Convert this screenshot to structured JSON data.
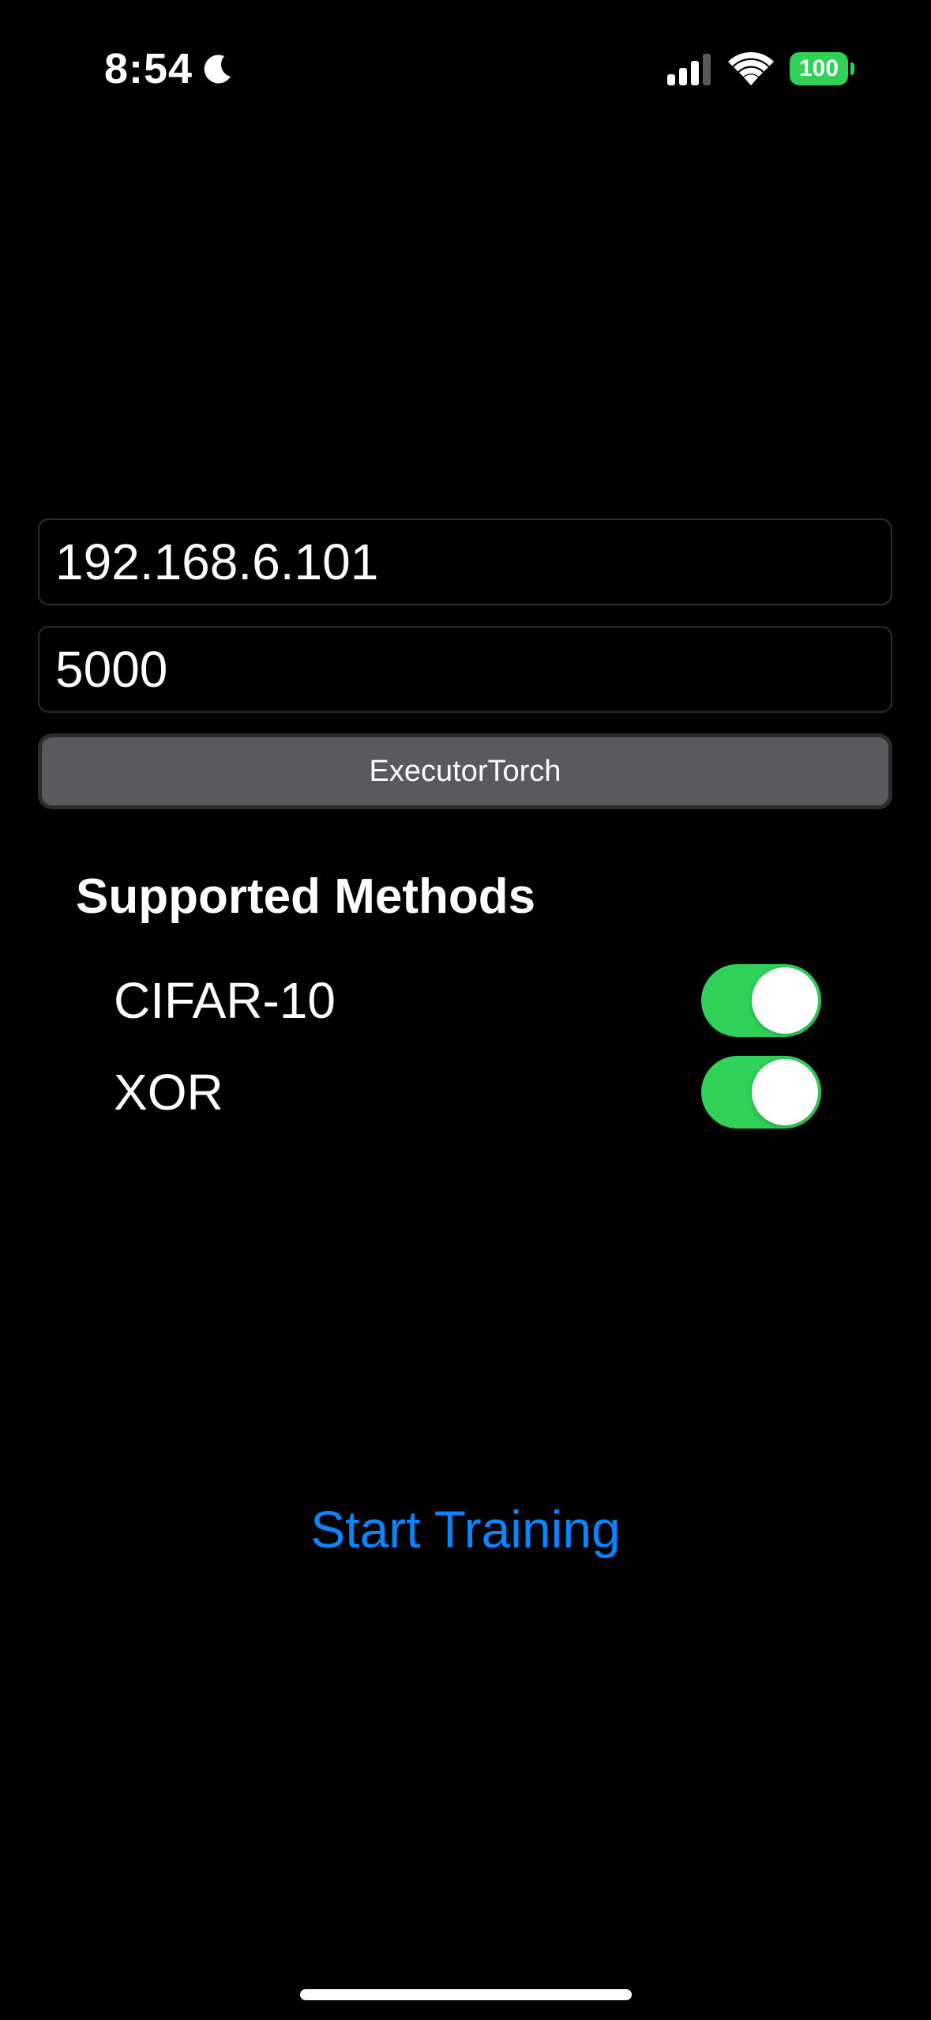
{
  "status_bar": {
    "time": "8:54",
    "battery_level": "100",
    "focus_icon": "moon-icon",
    "signal_icon": "cellular-signal-icon",
    "wifi_icon": "wifi-icon"
  },
  "form": {
    "host_value": "192.168.6.101",
    "port_value": "5000",
    "engine_button_label": "ExecutorTorch"
  },
  "methods": {
    "title": "Supported Methods",
    "items": [
      {
        "label": "CIFAR-10",
        "enabled": true
      },
      {
        "label": "XOR",
        "enabled": true
      }
    ]
  },
  "actions": {
    "start_label": "Start Training"
  },
  "colors": {
    "background": "#000000",
    "accent_blue": "#0a84ff",
    "toggle_on": "#30d158",
    "battery": "#30d158",
    "field_border": "#2c2c2e",
    "button_fill": "#5a5a5e"
  }
}
